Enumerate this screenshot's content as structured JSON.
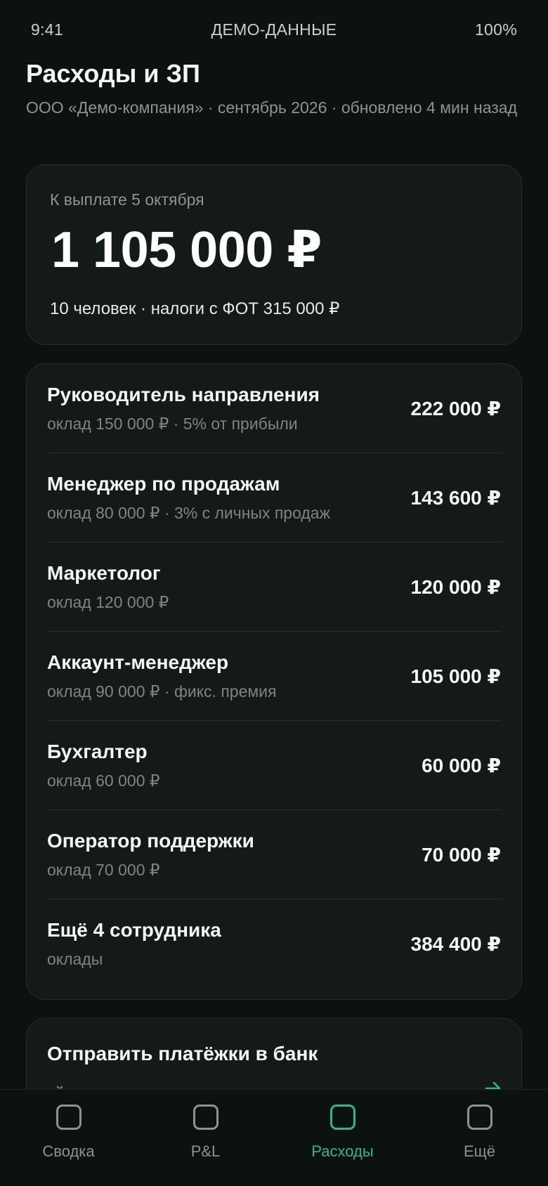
{
  "status_bar": {
    "time": "9:41",
    "mode": "ДЕМО-ДАННЫЕ",
    "battery": "100%"
  },
  "header": {
    "title": "Расходы и ЗП",
    "subtitle": "ООО «Демо-компания» · сентябрь 2026 · обновлено 4 мин назад"
  },
  "payout": {
    "label": "К выплате 5 октября",
    "amount": "1 105 000 ₽",
    "note": "10 человек · налоги с ФОТ 315 000 ₽"
  },
  "employees": [
    {
      "name": "Руководитель направления",
      "detail": "оклад 150 000 ₽ · 5% от прибыли",
      "amount": "222 000 ₽"
    },
    {
      "name": "Менеджер по продажам",
      "detail": "оклад 80 000 ₽ · 3% с личных продаж",
      "amount": "143 600 ₽"
    },
    {
      "name": "Маркетолог",
      "detail": "оклад 120 000 ₽",
      "amount": "120 000 ₽"
    },
    {
      "name": "Аккаунт-менеджер",
      "detail": "оклад 90 000 ₽ · фикс. премия",
      "amount": "105 000 ₽"
    },
    {
      "name": "Бухгалтер",
      "detail": "оклад 60 000 ₽",
      "amount": "60 000 ₽"
    },
    {
      "name": "Оператор поддержки",
      "detail": "оклад 70 000 ₽",
      "amount": "70 000 ₽"
    },
    {
      "name": "Ещё 4 сотрудника",
      "detail": "оклады",
      "amount": "384 400 ₽"
    }
  ],
  "action": {
    "title": "Отправить платёжки в банк",
    "description": "уйдут «на подпись», деньги — после вашего",
    "arrow_icon": "arrow-right-icon"
  },
  "nav": {
    "items": [
      {
        "label": "Сводка",
        "icon": "square-icon",
        "active": false
      },
      {
        "label": "P&L",
        "icon": "square-icon",
        "active": false
      },
      {
        "label": "Расходы",
        "icon": "square-icon",
        "active": true
      },
      {
        "label": "Ещё",
        "icon": "square-icon",
        "active": false
      }
    ]
  },
  "colors": {
    "background": "#0c1211",
    "card": "#131a19",
    "accent": "#2fb886",
    "muted_text": "#8b9592"
  }
}
